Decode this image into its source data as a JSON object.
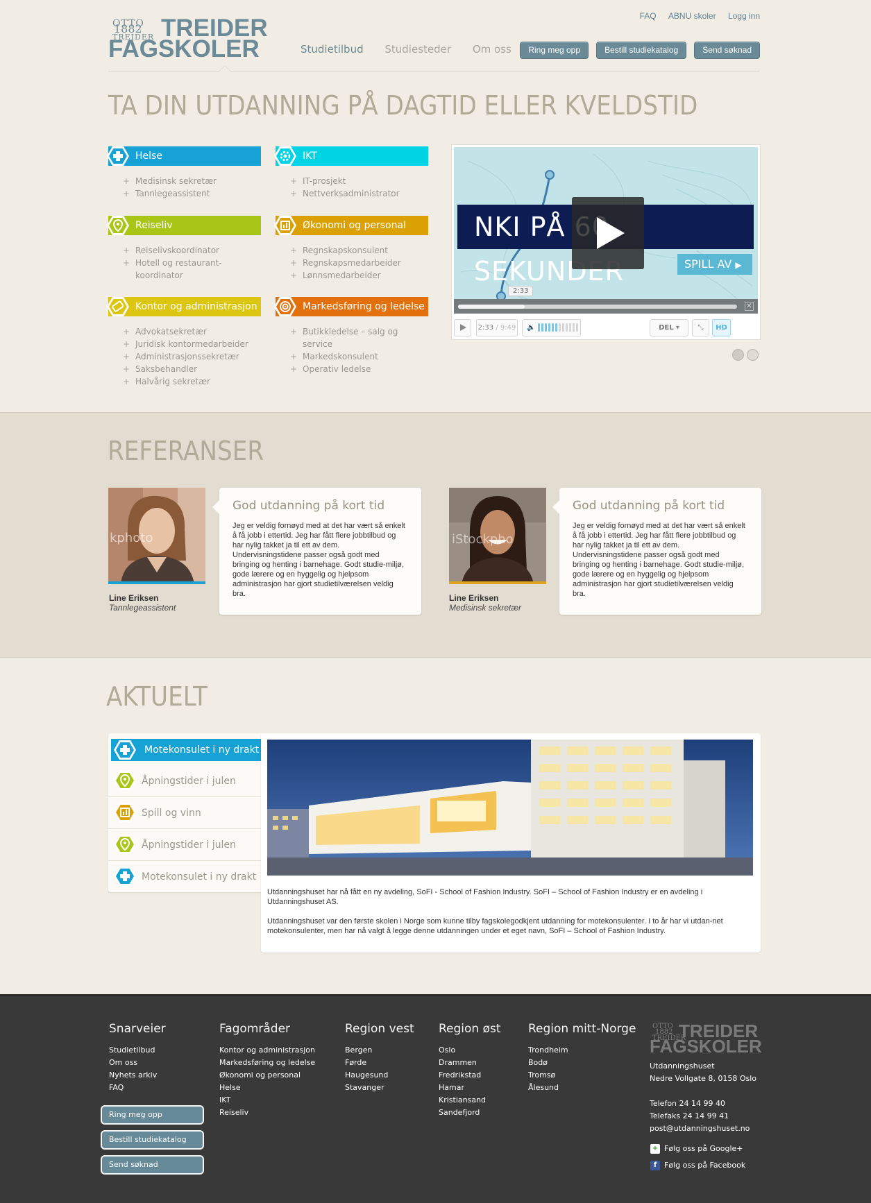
{
  "header": {
    "logo": {
      "otto": "OTTO",
      "year": "1882",
      "treider_small": "TREIDER",
      "word1": "TREIDER",
      "word2": "FAGSKOLER"
    },
    "toplinks": [
      "FAQ",
      "ABNU skoler",
      "Logg inn"
    ],
    "nav": [
      "Studietilbud",
      "Studiesteder",
      "Om oss"
    ],
    "cta": [
      "Ring meg opp",
      "Bestill studiekatalog",
      "Send søknad"
    ]
  },
  "headline": "TA DIN UTDANNING PÅ DAGTID ELLER KVELDSTID",
  "categories": [
    {
      "title": "Helse",
      "color": "#17a2d6",
      "icon": "cross-icon",
      "items": [
        "Medisinsk sekretær",
        "Tannlegeassistent"
      ]
    },
    {
      "title": "IKT",
      "color": "#00d3e3",
      "icon": "gear-icon",
      "items": [
        "IT-prosjekt",
        "Nettverksadministrator"
      ]
    },
    {
      "title": "Reiseliv",
      "color": "#a9c617",
      "icon": "pin-icon",
      "items": [
        "Reiselivskoordinator",
        "Hotell og restaurant-koordinator"
      ]
    },
    {
      "title": "Økonomi og personal",
      "color": "#dba104",
      "icon": "chart-icon",
      "items": [
        "Regnskapskonsulent",
        "Regnskapsmedarbeider",
        "Lønnsmedarbeider"
      ]
    },
    {
      "title": "Kontor og administrasjon",
      "color": "#dcc611",
      "icon": "tag-icon",
      "items": [
        "Advokatsekretær",
        "Juridisk kontormedarbeider",
        "Administrasjonssekretær",
        "Saksbehandler",
        "Halvårig sekretær"
      ]
    },
    {
      "title": "Markedsføring og ledelse",
      "color": "#e2700c",
      "icon": "target-icon",
      "items": [
        "Butikkledelse – salg og service",
        "Markedskonsulent",
        "Operativ ledelse"
      ]
    }
  ],
  "video": {
    "banner": "NKI PÅ 60 SEKUNDER",
    "play_label": "SPILL AV",
    "tooltip": "2:33",
    "time_current": "2:33",
    "time_total": "9:49",
    "progress_fraction": 0.24,
    "share_label": "DEL",
    "hd_label": "HD",
    "close_label": "✕"
  },
  "references": {
    "title": "REFERANSER",
    "items": [
      {
        "name": "Line Eriksen",
        "role": "Tannlegeassistent",
        "watermark": "kphoto",
        "quote_title": "God utdanning på kort tid",
        "quote_text": "Jeg er veldig fornøyd med at det har vært så enkelt å få jobb i ettertid. Jeg har fått flere jobbtilbud og har nylig takket ja til ett av dem. Undervisningstidene passer også godt med bringing og henting i barnehage. Godt studie-miljø, gode lærere og en hyggelig og hjelpsom administrasjon har gjort studietilværelsen veldig bra."
      },
      {
        "name": "Line Eriksen",
        "role": "Medisinsk sekretær",
        "watermark": "iStockpho",
        "quote_title": "God utdanning på kort tid",
        "quote_text": "Jeg er veldig fornøyd med at det har vært så enkelt å få jobb i ettertid. Jeg har fått flere jobbtilbud og har nylig takket ja til ett av dem. Undervisningstidene passer også godt med bringing og henting i barnehage. Godt studie-miljø, gode lærere og en hyggelig og hjelpsom administrasjon har gjort studietilværelsen veldig bra."
      }
    ]
  },
  "news": {
    "title": "AKTUELT",
    "items": [
      {
        "label": "Motekonsulet i ny drakt",
        "color": "#17a2d6",
        "icon": "cross-icon"
      },
      {
        "label": "Åpningstider i julen",
        "color": "#a9c617",
        "icon": "pin-icon"
      },
      {
        "label": "Spill og vinn",
        "color": "#dba104",
        "icon": "chart-icon"
      },
      {
        "label": "Åpningstider i julen",
        "color": "#a9c617",
        "icon": "pin-icon"
      },
      {
        "label": "Motekonsulet i ny drakt",
        "color": "#17a2d6",
        "icon": "cross-icon"
      }
    ],
    "paragraphs": [
      "Utdanningshuset har nå fått en ny avdeling, SoFI - School of Fashion Industry. SoFI – School of Fashion Industry er en avdeling i Utdanningshuset AS.",
      "Utdanningshuset var den første skolen i Norge som kunne tilby fagskolegodkjent utdanning for motekonsulenter. I to år har vi utdan-net motekonsulenter, men har nå valgt å legge denne utdanningen under et eget navn, SoFI – School of Fashion Industry."
    ]
  },
  "footer": {
    "columns": [
      {
        "title": "Snarveier",
        "links": [
          "Studietilbud",
          "Om oss",
          "Nyhets arkiv",
          "FAQ"
        ]
      },
      {
        "title": "Fagområder",
        "links": [
          "Kontor og administrasjon",
          "Markedsføring og ledelse",
          "Økonomi og personal",
          "Helse",
          "IKT",
          "Reiseliv"
        ]
      },
      {
        "title": "Region vest",
        "links": [
          "Bergen",
          "Førde",
          "Haugesund",
          "Stavanger"
        ]
      },
      {
        "title": "Region øst",
        "links": [
          "Oslo",
          "Drammen",
          "Fredrikstad",
          "Hamar",
          "Kristiansand",
          "Sandefjord"
        ]
      },
      {
        "title": "Region mitt-Norge",
        "links": [
          "Trondheim",
          "Bodø",
          "Tromsø",
          "Ålesund"
        ]
      }
    ],
    "buttons": [
      "Ring meg opp",
      "Bestill studiekatalog",
      "Send søknad"
    ],
    "contact": [
      "Utdanningshuset",
      "Nedre Vollgate 8, 0158 Oslo",
      "",
      "Telefon 24 14 99 40",
      "Telefaks 24 14 99 41",
      "post@utdanningshuset.no"
    ],
    "social": [
      "Følg oss på Google+",
      "Følg oss på Facebook"
    ]
  }
}
